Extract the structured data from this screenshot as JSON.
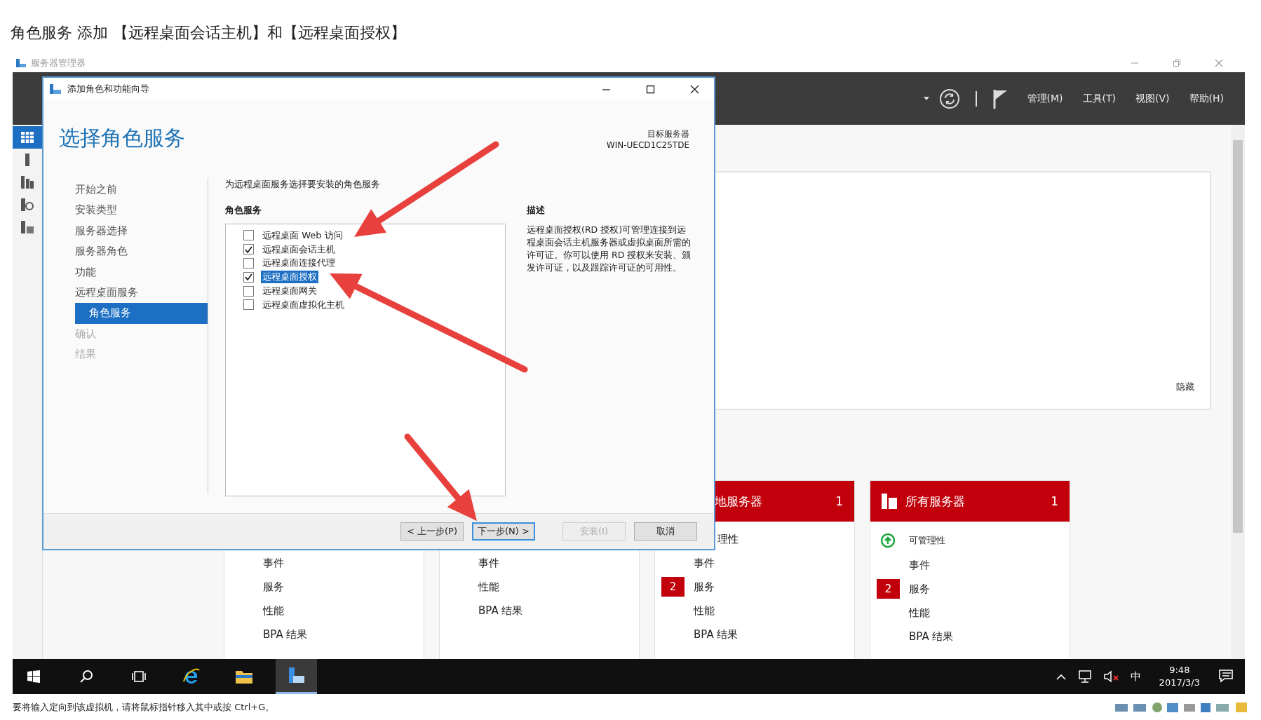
{
  "heading": "角色服务 添加 【远程桌面会话主机】和【远程桌面授权】",
  "window": {
    "title": "服务器管理器",
    "menu": [
      "管理(M)",
      "工具(T)",
      "视图(V)",
      "帮助(H)"
    ],
    "nav": [
      {
        "kind": "dashboard",
        "selected": true
      },
      {
        "kind": "local",
        "selected": false
      },
      {
        "kind": "all",
        "selected": false
      },
      {
        "kind": "iis",
        "selected": false
      },
      {
        "kind": "files",
        "selected": false
      }
    ],
    "welcome": {
      "hide_link": "隐藏"
    },
    "tiles": [
      {
        "rows": [
          {
            "kind": "item",
            "label": "事件"
          },
          {
            "kind": "item",
            "label": "服务"
          },
          {
            "kind": "item",
            "label": "性能"
          },
          {
            "kind": "item",
            "label": "BPA 结果"
          }
        ]
      },
      {
        "rows": [
          {
            "kind": "item",
            "label": "事件"
          },
          {
            "kind": "item",
            "label": "性能"
          },
          {
            "kind": "item",
            "label": "BPA 结果"
          }
        ]
      },
      {
        "header": {
          "kind": "cut",
          "title": "地服务器",
          "count": "1"
        },
        "rows": [
          {
            "kind": "cut",
            "label": "理性"
          },
          {
            "kind": "item",
            "label": "事件"
          },
          {
            "kind": "item",
            "label": "服务",
            "badge": "2"
          },
          {
            "kind": "item",
            "label": "性能"
          },
          {
            "kind": "item",
            "label": "BPA 结果"
          }
        ]
      },
      {
        "header": {
          "kind": "servers",
          "title": "所有服务器",
          "count": "1"
        },
        "rows": [
          {
            "kind": "status",
            "label": "可管理性"
          },
          {
            "kind": "item",
            "label": "事件"
          },
          {
            "kind": "item",
            "label": "服务",
            "badge": "2"
          },
          {
            "kind": "item",
            "label": "性能"
          },
          {
            "kind": "item",
            "label": "BPA 结果"
          }
        ]
      }
    ]
  },
  "dialog": {
    "title": "添加角色和功能向导",
    "heading": "选择角色服务",
    "target_label": "目标服务器",
    "target_server": "WIN-UECD1C25TDE",
    "steps": [
      {
        "label": "开始之前",
        "selected": false,
        "disabled": false
      },
      {
        "label": "安装类型",
        "selected": false,
        "disabled": false
      },
      {
        "label": "服务器选择",
        "selected": false,
        "disabled": false
      },
      {
        "label": "服务器角色",
        "selected": false,
        "disabled": false
      },
      {
        "label": "功能",
        "selected": false,
        "disabled": false
      },
      {
        "label": "远程桌面服务",
        "selected": false,
        "disabled": false,
        "children": [
          {
            "label": "角色服务",
            "selected": true,
            "disabled": false
          }
        ]
      },
      {
        "label": "确认",
        "selected": false,
        "disabled": true
      },
      {
        "label": "结果",
        "selected": false,
        "disabled": true
      }
    ],
    "instruction": "为远程桌面服务选择要安装的角色服务",
    "section_label": "角色服务",
    "role_services": [
      {
        "label": "远程桌面 Web 访问",
        "checked": false,
        "selected": false
      },
      {
        "label": "远程桌面会话主机",
        "checked": true,
        "selected": false
      },
      {
        "label": "远程桌面连接代理",
        "checked": false,
        "selected": false
      },
      {
        "label": "远程桌面授权",
        "checked": true,
        "selected": true
      },
      {
        "label": "远程桌面网关",
        "checked": false,
        "selected": false
      },
      {
        "label": "远程桌面虚拟化主机",
        "checked": false,
        "selected": false
      }
    ],
    "description_label": "描述",
    "description": "远程桌面授权(RD 授权)可管理连接到远程桌面会话主机服务器或虚拟桌面所需的许可证。你可以使用 RD 授权来安装、颁发许可证，以及跟踪许可证的可用性。",
    "buttons": [
      {
        "label": "< 上一步(P)",
        "disabled": false,
        "focused": false
      },
      {
        "label": "下一步(N) >",
        "disabled": false,
        "focused": true
      },
      {
        "label": "安装(I)",
        "disabled": true,
        "focused": false
      },
      {
        "label": "取消",
        "disabled": false,
        "focused": false
      }
    ]
  },
  "taskbar": {
    "apps": [
      {
        "kind": "start",
        "selected": false
      },
      {
        "kind": "search",
        "selected": false
      },
      {
        "kind": "taskview",
        "selected": false
      },
      {
        "kind": "browser",
        "selected": false
      },
      {
        "kind": "folder",
        "selected": false
      },
      {
        "kind": "server",
        "selected": true
      }
    ],
    "ime": "中",
    "time": "9:48",
    "date": "2017/3/3"
  },
  "status_text": "要将输入定向到该虚拟机，请将鼠标指针移入其中或按 Ctrl+G。"
}
